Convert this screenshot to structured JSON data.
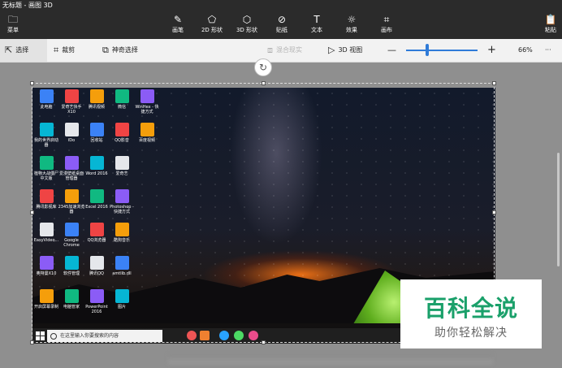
{
  "window": {
    "title": "无标题 - 画图 3D"
  },
  "ribbon": {
    "menu": "菜单",
    "tools": [
      {
        "label": "画笔",
        "icon": "brush-icon",
        "glyph": "✎"
      },
      {
        "label": "2D 形状",
        "icon": "2d-shapes-icon",
        "glyph": "⬠"
      },
      {
        "label": "3D 形状",
        "icon": "3d-shapes-icon",
        "glyph": "⬡"
      },
      {
        "label": "贴纸",
        "icon": "stickers-icon",
        "glyph": "⊘"
      },
      {
        "label": "文本",
        "icon": "text-icon",
        "glyph": "T"
      },
      {
        "label": "效果",
        "icon": "effects-icon",
        "glyph": "☼"
      },
      {
        "label": "画布",
        "icon": "canvas-icon",
        "glyph": "⌗"
      }
    ],
    "paste": "粘贴"
  },
  "toolbar": {
    "select": "选择",
    "crop": "裁剪",
    "magic_select": "神奇选择",
    "mixed_reality": "混合现实",
    "view3d": "3D 视图",
    "minus": "—",
    "plus": "+",
    "zoom": "66%",
    "more": "···",
    "zoom_fraction": 0.3
  },
  "desktop": {
    "icons": [
      [
        "此电脑",
        "爱奇艺快手X10",
        "腾讯视频",
        "微信",
        "WinHex - 快捷方式"
      ],
      [
        "我的世界启动器",
        "iDo",
        "回收站",
        "QQ影音",
        "百度视频"
      ],
      [
        "植物大战僵尸中文版",
        "爱漫壁纸桌面管理器",
        "Word 2016",
        "爱奇艺"
      ],
      [
        "腾讯影视库",
        "2345加速浏览器",
        "Excel 2016",
        "Photoshop - 快捷方式"
      ],
      [
        "EasyVideo...",
        "Google Chrome",
        "QQ浏览器",
        "酷狗音乐"
      ],
      [
        "奥特曼X10",
        "软件管理",
        "腾讯QQ",
        "amtlib.dll"
      ],
      [
        "开启屏幕录制",
        "电脑管家",
        "PowerPoint 2016",
        "图片"
      ]
    ],
    "taskbar_search": "在这里输入你要搜索的内容"
  },
  "watermark": {
    "title": "百科全说",
    "subtitle": "助你轻松解决"
  },
  "colors": {
    "accent": "#2f7bd8",
    "watermark": "#1aa06a"
  }
}
